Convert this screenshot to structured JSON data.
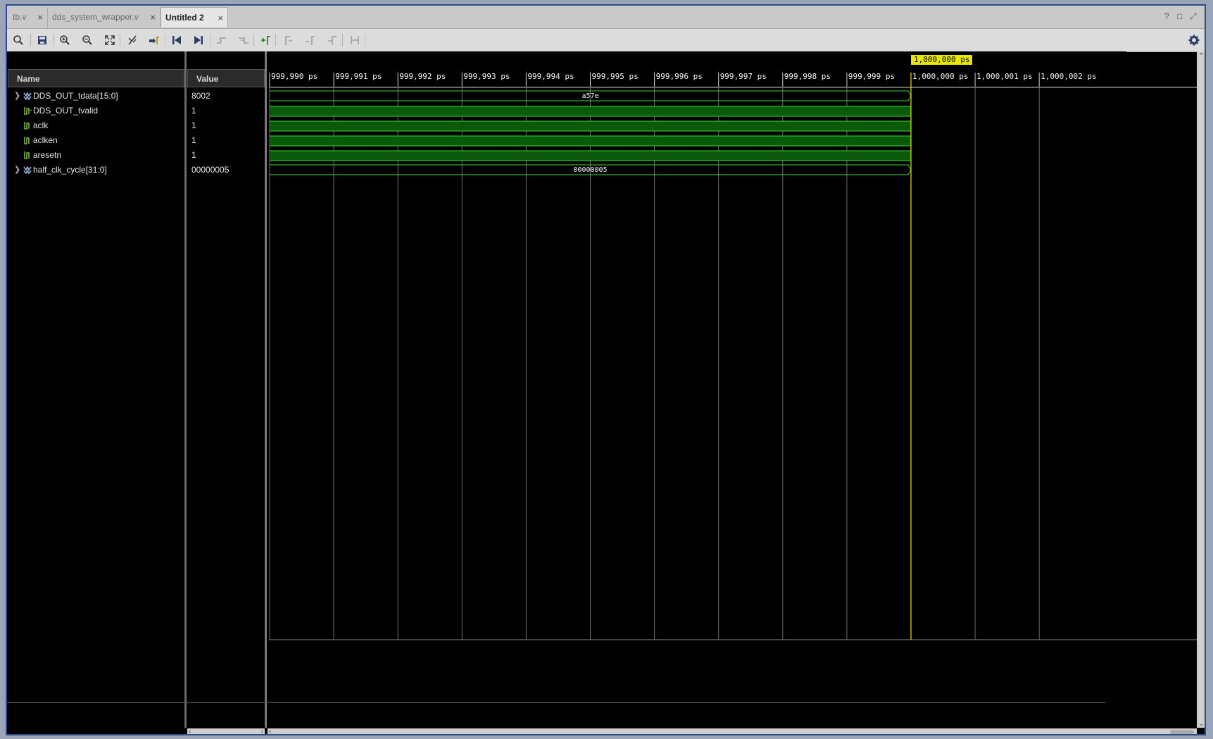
{
  "tabs": [
    {
      "label": "tb.v",
      "active": false
    },
    {
      "label": "dds_system_wrapper.v",
      "active": false
    },
    {
      "label": "Untitled 2",
      "active": true
    }
  ],
  "tab_close_glyph": "×",
  "window_controls": [
    "?",
    "□",
    "⤢"
  ],
  "toolbar": [
    {
      "icon": "search-icon",
      "enabled": true
    },
    {
      "icon": "save-icon",
      "enabled": true
    },
    {
      "icon": "zoom-in-icon",
      "enabled": true
    },
    {
      "icon": "zoom-out-icon",
      "enabled": true
    },
    {
      "icon": "zoom-fit-icon",
      "enabled": true
    },
    {
      "icon": "snap-cursor-icon",
      "enabled": true
    },
    {
      "icon": "goto-cursor-icon",
      "enabled": true
    },
    {
      "icon": "goto-start-icon",
      "enabled": true
    },
    {
      "icon": "goto-end-icon",
      "enabled": true
    },
    {
      "icon": "prev-transition-icon",
      "enabled": false
    },
    {
      "icon": "next-transition-icon",
      "enabled": false
    },
    {
      "icon": "add-marker-icon",
      "enabled": true
    },
    {
      "icon": "prev-marker-icon",
      "enabled": false
    },
    {
      "icon": "next-marker-icon",
      "enabled": false
    },
    {
      "icon": "swap-cursors-icon",
      "enabled": false
    },
    {
      "icon": "cursor-range-icon",
      "enabled": false
    }
  ],
  "columns": {
    "name": "Name",
    "value": "Value"
  },
  "signals": [
    {
      "name": "DDS_OUT_tdata[15:0]",
      "value": "8002",
      "type": "bus",
      "expandable": true,
      "wave_value": "a57e"
    },
    {
      "name": "DDS_OUT_tvalid",
      "value": "1",
      "type": "bit",
      "expandable": false
    },
    {
      "name": "aclk",
      "value": "1",
      "type": "bit",
      "expandable": false
    },
    {
      "name": "aclken",
      "value": "1",
      "type": "bit",
      "expandable": false
    },
    {
      "name": "aresetn",
      "value": "1",
      "type": "bit",
      "expandable": false
    },
    {
      "name": "half_clk_cycle[31:0]",
      "value": "00000005",
      "type": "bus",
      "expandable": true,
      "wave_value": "00000005"
    }
  ],
  "timeline": {
    "ticks": [
      "999,990 ps",
      "999,991 ps",
      "999,992 ps",
      "999,993 ps",
      "999,994 ps",
      "999,995 ps",
      "999,996 ps",
      "999,997 ps",
      "999,998 ps",
      "999,999 ps",
      "1,000,000 ps",
      "1,000,001 ps",
      "1,000,002 ps"
    ],
    "cursor_label": "1,000,000 ps",
    "sim_end_tick": "1,000,000 ps"
  },
  "colors": {
    "wave_line": "#3ad43a",
    "wave_fill": "#0a5a0a",
    "cursor": "#e6e600",
    "grid": "#6a6a6a"
  }
}
